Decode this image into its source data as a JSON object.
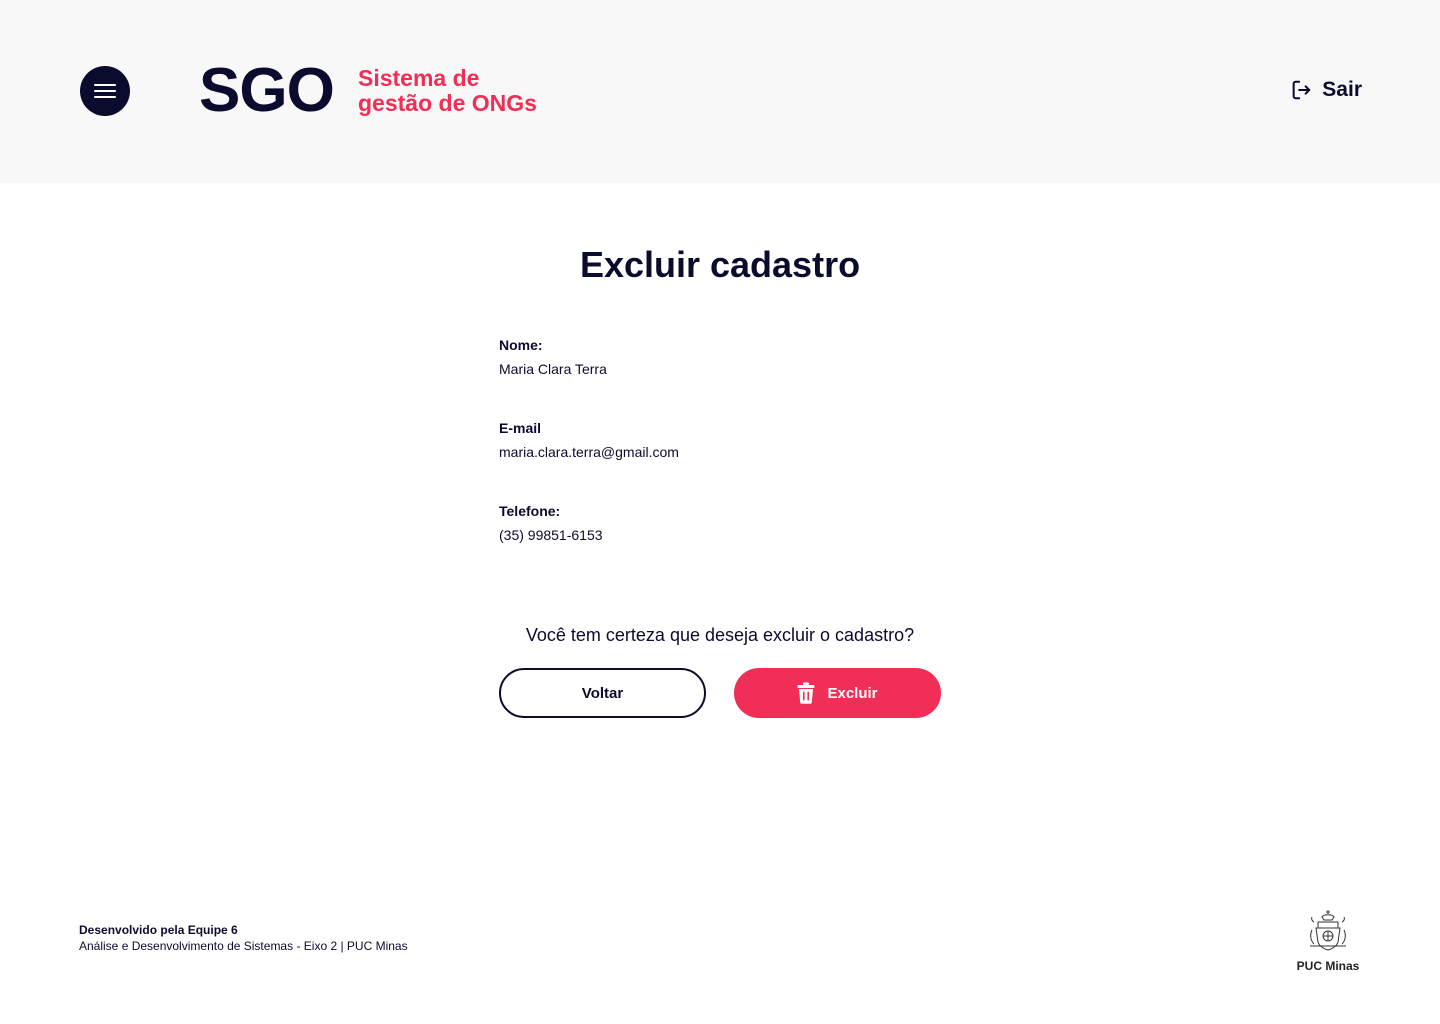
{
  "header": {
    "logo": "SGO",
    "subtitle_line1": "Sistema de",
    "subtitle_line2": "gestão de ONGs",
    "logout_label": "Sair"
  },
  "page": {
    "title": "Excluir cadastro"
  },
  "fields": [
    {
      "label": "Nome:",
      "value": "Maria Clara Terra"
    },
    {
      "label": "E-mail",
      "value": "maria.clara.terra@gmail.com"
    },
    {
      "label": "Telefone:",
      "value": "(35) 99851-6153"
    }
  ],
  "confirm": {
    "question": "Você tem certeza que deseja excluir o cadastro?",
    "back_label": "Voltar",
    "delete_label": "Excluir"
  },
  "footer": {
    "line1": "Desenvolvido pela Equipe 6",
    "line2": "Análise e Desenvolvimento de Sistemas - Eixo 2 | PUC Minas",
    "logo_text": "PUC Minas"
  },
  "colors": {
    "navy": "#0b0b2e",
    "accent": "#f12e55",
    "header_bg": "#f8f8f8"
  },
  "icons": {
    "menu": "hamburger-menu-icon",
    "logout": "logout-icon",
    "delete": "trash-icon",
    "footer_logo": "puc-minas-crest"
  }
}
